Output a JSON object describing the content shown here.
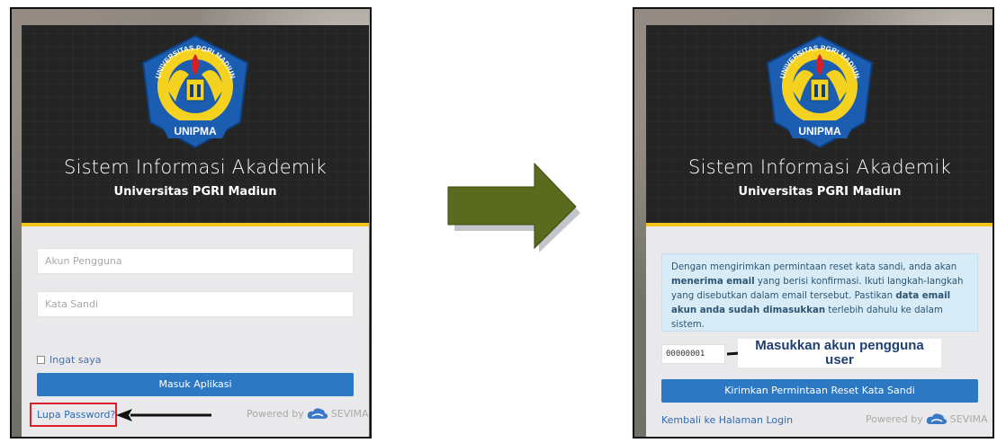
{
  "before": {
    "app_title": "Sistem Informasi Akademik",
    "university": "Universitas PGRI Madiun",
    "logo_top_text": "UNIVERSITAS PGRI MADIUN",
    "logo_bottom_text": "UNIPMA",
    "username_placeholder": "Akun Pengguna",
    "password_placeholder": "Kata Sandi",
    "remember_label": "Ingat saya",
    "login_button": "Masuk Aplikasi",
    "forgot_link": "Lupa Password?",
    "powered_by": "Powered by",
    "brand": "SEVIMA"
  },
  "after": {
    "app_title": "Sistem Informasi Akademik",
    "university": "Universitas PGRI Madiun",
    "logo_top_text": "UNIVERSITAS PGRI MADIUN",
    "logo_bottom_text": "UNIPMA",
    "info_part1": "Dengan mengirimkan permintaan reset kata sandi, anda akan ",
    "info_bold1": "menerima email",
    "info_part2": " yang berisi konfirmasi. Ikuti langkah-langkah yang disebutkan dalam email tersebut. Pastikan ",
    "info_bold2": "data email akun anda sudah dimasukkan",
    "info_part3": " terlebih dahulu ke dalam sistem.",
    "username_value": "00000001",
    "annotation": "Masukkan akun pengguna user",
    "submit_button": "Kirimkan Permintaan Reset Kata Sandi",
    "back_link": "Kembali ke Halaman Login",
    "powered_by": "Powered by",
    "brand": "SEVIMA"
  },
  "colors": {
    "header_bg": "#242424",
    "accent_yellow": "#f2c418",
    "button_blue": "#2d78c3",
    "link_blue": "#2d6bb5",
    "annotation_red": "#d81f26",
    "arrow_green": "#5b6b1e",
    "info_bg": "#d8ecf7"
  }
}
